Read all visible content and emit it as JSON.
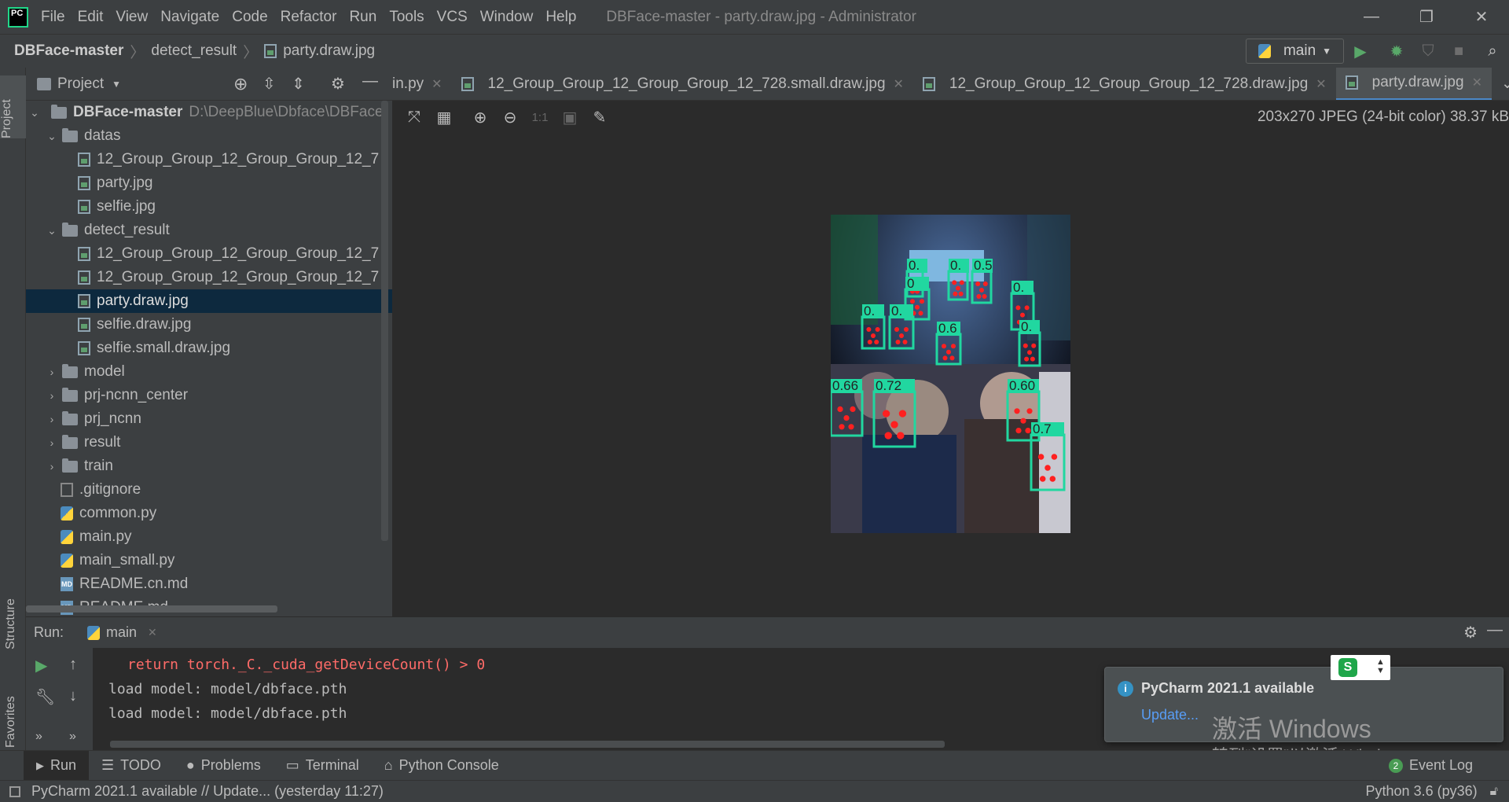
{
  "titlebar": {
    "menus": [
      "File",
      "Edit",
      "View",
      "Navigate",
      "Code",
      "Refactor",
      "Run",
      "Tools",
      "VCS",
      "Window",
      "Help"
    ],
    "window_title": "DBFace-master - party.draw.jpg - Administrator",
    "logo_text": "PC"
  },
  "navbar": {
    "breadcrumb": [
      "DBFace-master",
      "detect_result",
      "party.draw.jpg"
    ],
    "run_config": "main"
  },
  "project_panel": {
    "title": "Project",
    "root_label": "DBFace-master",
    "root_path": "D:\\DeepBlue\\Dbface\\DBFace-",
    "tree": [
      {
        "label": "datas",
        "type": "folder",
        "depth": 1,
        "expanded": true
      },
      {
        "label": "12_Group_Group_12_Group_Group_12_7",
        "type": "image",
        "depth": 2
      },
      {
        "label": "party.jpg",
        "type": "image",
        "depth": 2
      },
      {
        "label": "selfie.jpg",
        "type": "image",
        "depth": 2
      },
      {
        "label": "detect_result",
        "type": "folder",
        "depth": 1,
        "expanded": true
      },
      {
        "label": "12_Group_Group_12_Group_Group_12_7",
        "type": "image",
        "depth": 2
      },
      {
        "label": "12_Group_Group_12_Group_Group_12_7",
        "type": "image",
        "depth": 2
      },
      {
        "label": "party.draw.jpg",
        "type": "image",
        "depth": 2,
        "selected": true
      },
      {
        "label": "selfie.draw.jpg",
        "type": "image",
        "depth": 2
      },
      {
        "label": "selfie.small.draw.jpg",
        "type": "image",
        "depth": 2
      },
      {
        "label": "model",
        "type": "folder",
        "depth": 1,
        "expanded": false
      },
      {
        "label": "prj-ncnn_center",
        "type": "folder",
        "depth": 1,
        "expanded": false
      },
      {
        "label": "prj_ncnn",
        "type": "folder",
        "depth": 1,
        "expanded": false
      },
      {
        "label": "result",
        "type": "folder",
        "depth": 1,
        "expanded": false
      },
      {
        "label": "train",
        "type": "folder",
        "depth": 1,
        "expanded": false
      },
      {
        "label": ".gitignore",
        "type": "git",
        "depth": 1
      },
      {
        "label": "common.py",
        "type": "python",
        "depth": 1
      },
      {
        "label": "main.py",
        "type": "python",
        "depth": 1
      },
      {
        "label": "main_small.py",
        "type": "python",
        "depth": 1
      },
      {
        "label": "README.cn.md",
        "type": "markdown",
        "depth": 1
      },
      {
        "label": "README.md",
        "type": "markdown",
        "depth": 1
      }
    ]
  },
  "left_strip": {
    "project": "Project",
    "structure": "Structure",
    "favorites": "Favorites"
  },
  "editor_tabs": [
    {
      "label": "in.py",
      "icon": "python-icon"
    },
    {
      "label": "12_Group_Group_12_Group_Group_12_728.small.draw.jpg",
      "icon": "image-file-icon"
    },
    {
      "label": "12_Group_Group_12_Group_Group_12_728.draw.jpg",
      "icon": "image-file-icon"
    },
    {
      "label": "party.draw.jpg",
      "icon": "image-file-icon",
      "active": true
    }
  ],
  "image_viewer": {
    "info": "203x270 JPEG (24-bit color) 38.37 kB",
    "zoom_label": "1:1",
    "detections": [
      "0.",
      "0",
      "0.",
      "0.5",
      "0.6",
      "0.",
      "0.",
      "0.",
      "0.",
      "0.66",
      "0.72",
      "0.60",
      "0.7"
    ]
  },
  "run_panel": {
    "label": "Run:",
    "tab": "main",
    "lines": [
      {
        "text": "return torch._C._cuda_getDeviceCount() > 0",
        "error": true
      },
      {
        "text": "load model: model/dbface.pth",
        "error": false
      },
      {
        "text": "load model: model/dbface.pth",
        "error": false
      }
    ]
  },
  "bottom_tabs": [
    "Run",
    "TODO",
    "Problems",
    "Terminal",
    "Python Console"
  ],
  "event_log": {
    "label": "Event Log",
    "count": "2"
  },
  "notification": {
    "title": "PyCharm 2021.1 available",
    "link": "Update..."
  },
  "activation": {
    "line1": "激活 Windows",
    "line2": "转到“设置”以激活 Windows。"
  },
  "statusbar": {
    "message": "PyCharm 2021.1 available // Update... (yesterday 11:27)",
    "interpreter": "Python 3.6 (py36)"
  },
  "colors": {
    "accent": "#4a88c7",
    "selection": "#0d293e",
    "error": "#ff6b68",
    "detect_box": "#21d7a0"
  }
}
